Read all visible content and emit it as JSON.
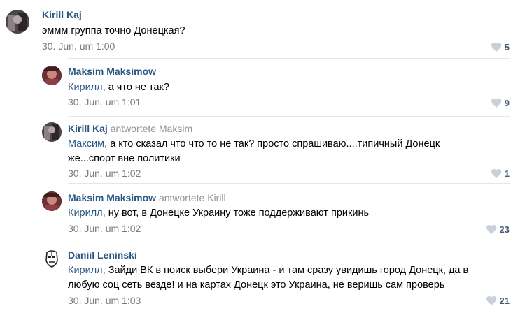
{
  "comments": [
    {
      "author": "Kirill Kaj",
      "replied_to": "",
      "mention": "",
      "text": "эммм группа точно Донецкая?",
      "date": "30. Jun. um 1:00",
      "likes": "5"
    },
    {
      "author": "Maksim Maksimow",
      "replied_to": "",
      "mention": "Кирилл",
      "text": ", а что не так?",
      "date": "30. Jun. um 1:01",
      "likes": "9"
    },
    {
      "author": "Kirill Kaj",
      "replied_to": "antwortete Maksim",
      "mention": "Максим",
      "text": ", а кто сказал что что то не так? просто спрашиваю....типичный Донецк же...спорт вне политики",
      "date": "30. Jun. um 1:02",
      "likes": "1"
    },
    {
      "author": "Maksim Maksimow",
      "replied_to": "antwortete Kirill",
      "mention": "Кирилл",
      "text": ", ну вот, в Донецке Украину тоже поддерживают прикинь",
      "date": "30. Jun. um 1:02",
      "likes": "23"
    },
    {
      "author": "Daniil Leninski",
      "replied_to": "",
      "mention": "Кирилл",
      "text": ", Зайди ВК в поиск выбери Украина - и там сразу увидишь город Донецк, да в любую соц сеть везде! и на картах Донецк это Украина, не веришь сам проверь",
      "date": "30. Jun. um 1:03",
      "likes": "21"
    }
  ],
  "colors": {
    "link": "#2a5885",
    "meta": "#939393",
    "date": "#7a7a7a",
    "like_icon": "#c9d0da",
    "separator": "#e4e6ea"
  },
  "icons": {
    "like": "heart-icon"
  }
}
